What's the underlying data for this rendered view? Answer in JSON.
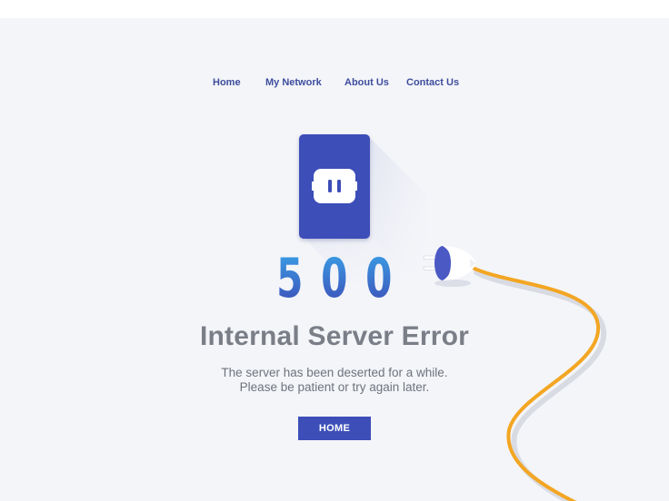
{
  "nav": {
    "items": [
      {
        "label": "Home"
      },
      {
        "label": "My Network"
      },
      {
        "label": "About Us"
      },
      {
        "label": "Contact Us"
      }
    ]
  },
  "error": {
    "code_digits": [
      "5",
      "0",
      "0"
    ],
    "title": "Internal Server Error",
    "message_line1": "The server has been deserted for a while.",
    "message_line2": "Please be patient or try again later."
  },
  "actions": {
    "home_label": "HOME"
  },
  "colors": {
    "background": "#f4f5f9",
    "accent": "#3d4eb8",
    "nav_text": "#3d4d9c",
    "cable": "#f3a623",
    "title_text": "#7a7e87"
  },
  "icons": {
    "socket": "power-socket-icon",
    "plug": "unplugged-plug-icon",
    "cable": "power-cable"
  }
}
